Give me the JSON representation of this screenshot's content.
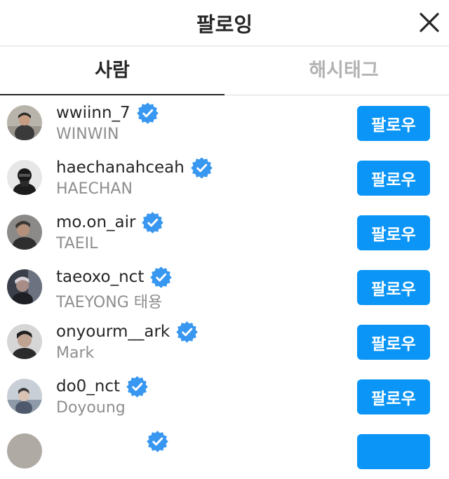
{
  "header": {
    "title": "팔로잉"
  },
  "tabs": [
    {
      "label": "사람",
      "active": true
    },
    {
      "label": "해시태그",
      "active": false
    }
  ],
  "colors": {
    "accent": "#0b95f6",
    "verified": "#3897f0",
    "secondary_text": "#8e8e8e",
    "inactive_tab": "#b3b3b3"
  },
  "users": [
    {
      "username": "wwiinn_7",
      "name": "WINWIN",
      "verified": true,
      "button": "팔로우"
    },
    {
      "username": "haechanahceah",
      "name": "HAECHAN",
      "verified": true,
      "button": "팔로우"
    },
    {
      "username": "mo.on_air",
      "name": "TAEIL",
      "verified": true,
      "button": "팔로우"
    },
    {
      "username": "taeoxo_nct",
      "name": "TAEYONG 태용",
      "verified": true,
      "button": "팔로우"
    },
    {
      "username": "onyourm__ark",
      "name": "Mark",
      "verified": true,
      "button": "팔로우"
    },
    {
      "username": "do0_nct",
      "name": "Doyoung",
      "verified": true,
      "button": "팔로우"
    }
  ]
}
